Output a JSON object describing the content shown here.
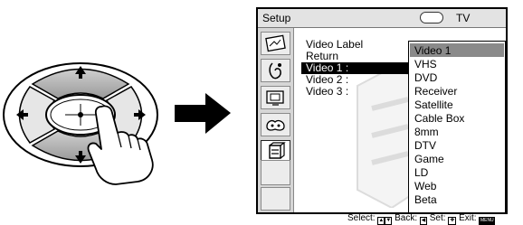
{
  "screen": {
    "title": "Setup",
    "input_label": "TV"
  },
  "menu": {
    "heading": "Video Label",
    "items": [
      "Return",
      "Video 1 :",
      "Video 2 :",
      "Video 3 :"
    ],
    "selected_item": "Video 1 :"
  },
  "dropdown": {
    "options": [
      "Video 1",
      "VHS",
      "DVD",
      "Receiver",
      "Satellite",
      "Cable Box",
      "8mm",
      "DTV",
      "Game",
      "LD",
      "Web",
      "Beta"
    ],
    "selected": "Video 1"
  },
  "sidebar": {
    "icons": [
      "picture-icon",
      "sound-icon",
      "screen-icon",
      "channel-icon",
      "setup-icon",
      "blank-slot",
      "blank-slot"
    ],
    "active_index": 4
  },
  "status": {
    "select_label": "Select:",
    "back_label": "Back:",
    "set_label": "Set:",
    "exit_label": "Exit:",
    "menu_key": "MENU"
  },
  "remote": {
    "buttons": [
      "up-arrow-button",
      "down-arrow-button",
      "left-arrow-button",
      "right-arrow-button",
      "center-select-button"
    ]
  }
}
